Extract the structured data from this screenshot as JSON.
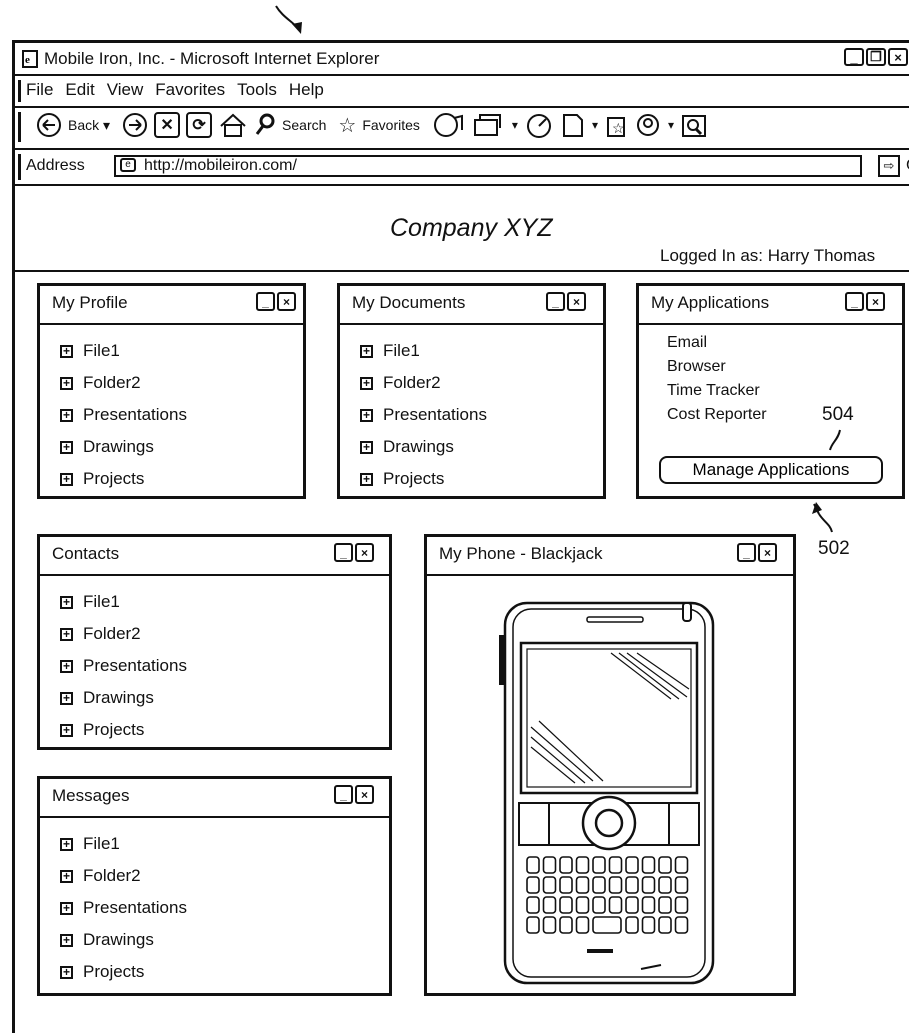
{
  "browser": {
    "title": "Mobile Iron, Inc. - Microsoft Internet Explorer",
    "menu": [
      "File",
      "Edit",
      "View",
      "Favorites",
      "Tools",
      "Help"
    ],
    "toolbar": {
      "back_label": "Back",
      "search_label": "Search",
      "favorites_label": "Favorites"
    },
    "address_label": "Address",
    "address_value": "http://mobileiron.com/",
    "go_label": "Go"
  },
  "header": {
    "company": "Company XYZ",
    "logged_in": "Logged In as: Harry Thomas"
  },
  "panels": {
    "profile": {
      "title": "My Profile",
      "items": [
        "File1",
        "Folder2",
        "Presentations",
        "Drawings",
        "Projects"
      ]
    },
    "documents": {
      "title": "My Documents",
      "items": [
        "File1",
        "Folder2",
        "Presentations",
        "Drawings",
        "Projects"
      ]
    },
    "applications": {
      "title": "My Applications",
      "items": [
        "Email",
        "Browser",
        "Time Tracker",
        "Cost Reporter"
      ],
      "manage_label": "Manage Applications"
    },
    "contacts": {
      "title": "Contacts",
      "items": [
        "File1",
        "Folder2",
        "Presentations",
        "Drawings",
        "Projects"
      ]
    },
    "messages": {
      "title": "Messages",
      "items": [
        "File1",
        "Folder2",
        "Presentations",
        "Drawings",
        "Projects"
      ]
    },
    "phone": {
      "title": "My Phone - Blackjack"
    }
  },
  "references": {
    "r504": "504",
    "r502": "502"
  },
  "icons": [
    "ie-page-icon",
    "back-icon",
    "forward-icon",
    "stop-icon",
    "refresh-icon",
    "home-icon",
    "search-icon",
    "star-icon",
    "media-icon",
    "mail-icon",
    "history-icon",
    "page-icon",
    "edit-icon",
    "messenger-icon",
    "research-icon"
  ]
}
